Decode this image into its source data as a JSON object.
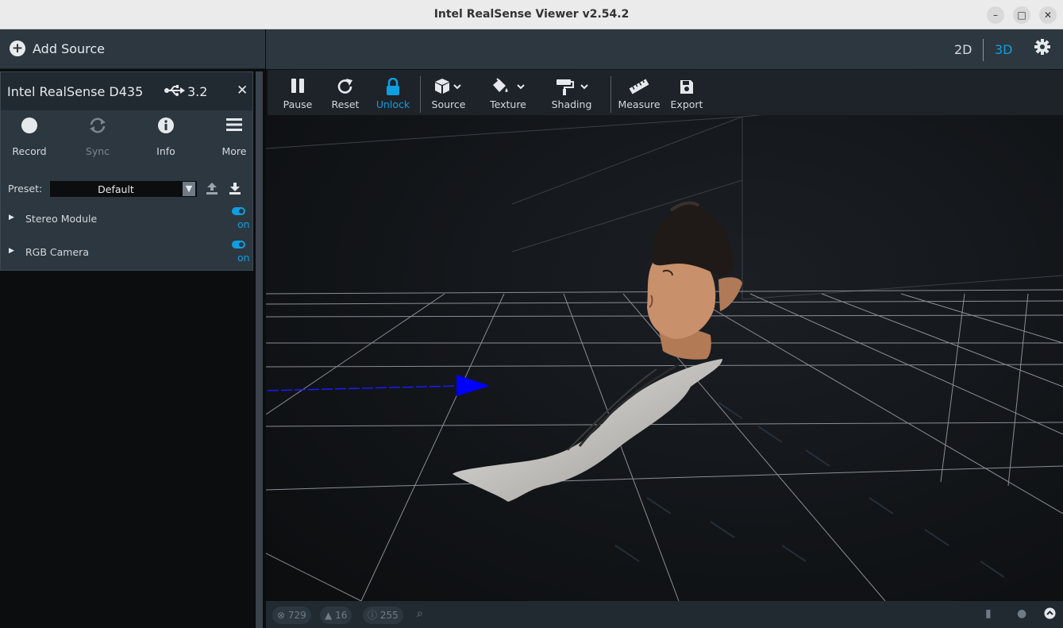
{
  "window": {
    "title": "Intel RealSense Viewer v2.54.2",
    "minimize": "–",
    "maximize": "□",
    "close": "✕"
  },
  "sidebar": {
    "add_source_label": "Add Source",
    "device": {
      "name": "Intel RealSense D435",
      "usb_icon": "usb-icon",
      "usb_version": "3.2",
      "close": "✕",
      "buttons": [
        {
          "label": "Record",
          "icon": "record-icon",
          "enabled": true
        },
        {
          "label": "Sync",
          "icon": "sync-icon",
          "enabled": false
        },
        {
          "label": "Info",
          "icon": "info-icon",
          "enabled": true
        },
        {
          "label": "More",
          "icon": "menu-icon",
          "enabled": true
        }
      ],
      "preset_label": "Preset:",
      "preset_value": "Default",
      "sensors": [
        {
          "name": "Stereo Module",
          "state": "on"
        },
        {
          "name": "RGB Camera",
          "state": "on"
        }
      ]
    }
  },
  "topbar": {
    "mode_2d": "2D",
    "mode_3d": "3D",
    "active_mode": "3D"
  },
  "toolbar": {
    "items": [
      {
        "label": "Pause",
        "icon": "pause-icon"
      },
      {
        "label": "Reset",
        "icon": "reset-icon"
      },
      {
        "label": "Unlock",
        "icon": "lock-icon",
        "active": true
      },
      {
        "label": "Source",
        "icon": "cube-icon",
        "dropdown": true
      },
      {
        "label": "Texture",
        "icon": "paint-bucket-icon",
        "dropdown": true
      },
      {
        "label": "Shading",
        "icon": "paint-roller-icon",
        "dropdown": true
      },
      {
        "label": "Measure",
        "icon": "ruler-icon"
      },
      {
        "label": "Export",
        "icon": "save-icon"
      }
    ]
  },
  "statusbar": {
    "errors": "729",
    "warnings": "16",
    "info": "255"
  },
  "colors": {
    "accent": "#0f9ee0",
    "panel": "#2d3740",
    "axis_z": "#0000ff"
  }
}
